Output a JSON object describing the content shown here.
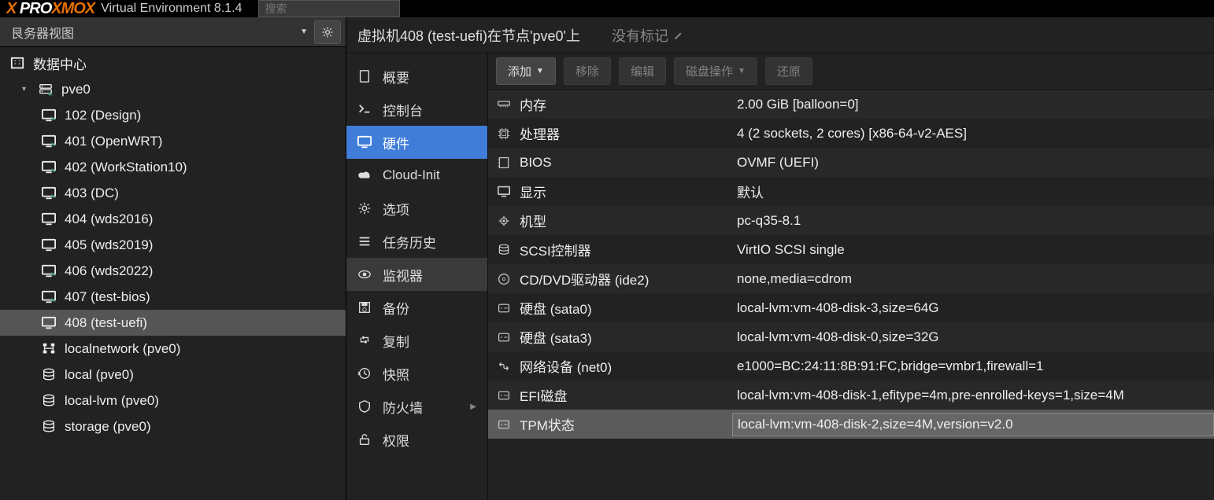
{
  "header": {
    "logo_left": "PRO",
    "logo_mid": "XMO",
    "logo_right": "X",
    "ve_label": "Virtual Environment 8.1.4",
    "search_placeholder": "搜索"
  },
  "viewbar": {
    "label": "艮务器视图"
  },
  "tree": {
    "datacenter": "数据中心",
    "node": "pve0",
    "vms": [
      {
        "id": "vm-102",
        "label": "102 (Design)",
        "running": true
      },
      {
        "id": "vm-401",
        "label": "401 (OpenWRT)",
        "running": true
      },
      {
        "id": "vm-402",
        "label": "402 (WorkStation10)",
        "running": true
      },
      {
        "id": "vm-403",
        "label": "403 (DC)",
        "running": true
      },
      {
        "id": "vm-404",
        "label": "404 (wds2016)",
        "running": false
      },
      {
        "id": "vm-405",
        "label": "405 (wds2019)",
        "running": false
      },
      {
        "id": "vm-406",
        "label": "406 (wds2022)",
        "running": true
      },
      {
        "id": "vm-407",
        "label": "407 (test-bios)",
        "running": true
      },
      {
        "id": "vm-408",
        "label": "408 (test-uefi)",
        "running": false,
        "selected": true
      }
    ],
    "extras": [
      {
        "id": "localnetwork",
        "label": "localnetwork (pve0)",
        "icon": "network"
      },
      {
        "id": "local",
        "label": "local (pve0)",
        "icon": "storage"
      },
      {
        "id": "local-lvm",
        "label": "local-lvm (pve0)",
        "icon": "storage"
      },
      {
        "id": "storage",
        "label": "storage (pve0)",
        "icon": "storage"
      }
    ]
  },
  "title": {
    "text": "虚拟机408 (test-uefi)在节点'pve0'上",
    "no_tags": "没有标记"
  },
  "nav": [
    {
      "id": "summary",
      "label": "概要",
      "icon": "book"
    },
    {
      "id": "console",
      "label": "控制台",
      "icon": "terminal"
    },
    {
      "id": "hardware",
      "label": "硬件",
      "icon": "display",
      "active": true
    },
    {
      "id": "cloudinit",
      "label": "Cloud-Init",
      "icon": "cloud"
    },
    {
      "id": "options",
      "label": "选项",
      "icon": "gear"
    },
    {
      "id": "taskhistory",
      "label": "任务历史",
      "icon": "list"
    },
    {
      "id": "monitor",
      "label": "监视器",
      "icon": "eye",
      "hover": true
    },
    {
      "id": "backup",
      "label": "备份",
      "icon": "save"
    },
    {
      "id": "replication",
      "label": "复制",
      "icon": "retweet"
    },
    {
      "id": "snapshots",
      "label": "快照",
      "icon": "history"
    },
    {
      "id": "firewall",
      "label": "防火墙",
      "icon": "shield",
      "expand": true
    },
    {
      "id": "permissions",
      "label": "权限",
      "icon": "unlock"
    }
  ],
  "toolbar": {
    "add": "添加",
    "remove": "移除",
    "edit": "编辑",
    "diskaction": "磁盘操作",
    "revert": "还原"
  },
  "hardware": [
    {
      "icon": "memory",
      "label": "内存",
      "value": "2.00 GiB [balloon=0]"
    },
    {
      "icon": "cpu",
      "label": "处理器",
      "value": "4 (2 sockets, 2 cores) [x86-64-v2-AES]"
    },
    {
      "icon": "bios",
      "label": "BIOS",
      "value": "OVMF (UEFI)"
    },
    {
      "icon": "display",
      "label": "显示",
      "value": "默认"
    },
    {
      "icon": "gears",
      "label": "机型",
      "value": "pc-q35-8.1"
    },
    {
      "icon": "db",
      "label": "SCSI控制器",
      "value": "VirtIO SCSI single"
    },
    {
      "icon": "disc",
      "label": "CD/DVD驱动器 (ide2)",
      "value": "none,media=cdrom"
    },
    {
      "icon": "hdd",
      "label": "硬盘 (sata0)",
      "value": "local-lvm:vm-408-disk-3,size=64G"
    },
    {
      "icon": "hdd",
      "label": "硬盘 (sata3)",
      "value": "local-lvm:vm-408-disk-0,size=32G"
    },
    {
      "icon": "net",
      "label": "网络设备 (net0)",
      "value": "e1000=BC:24:11:8B:91:FC,bridge=vmbr1,firewall=1"
    },
    {
      "icon": "hdd",
      "label": "EFI磁盘",
      "value": "local-lvm:vm-408-disk-1,efitype=4m,pre-enrolled-keys=1,size=4M"
    },
    {
      "icon": "hdd",
      "label": "TPM状态",
      "value": "local-lvm:vm-408-disk-2,size=4M,version=v2.0",
      "selected": true
    }
  ]
}
